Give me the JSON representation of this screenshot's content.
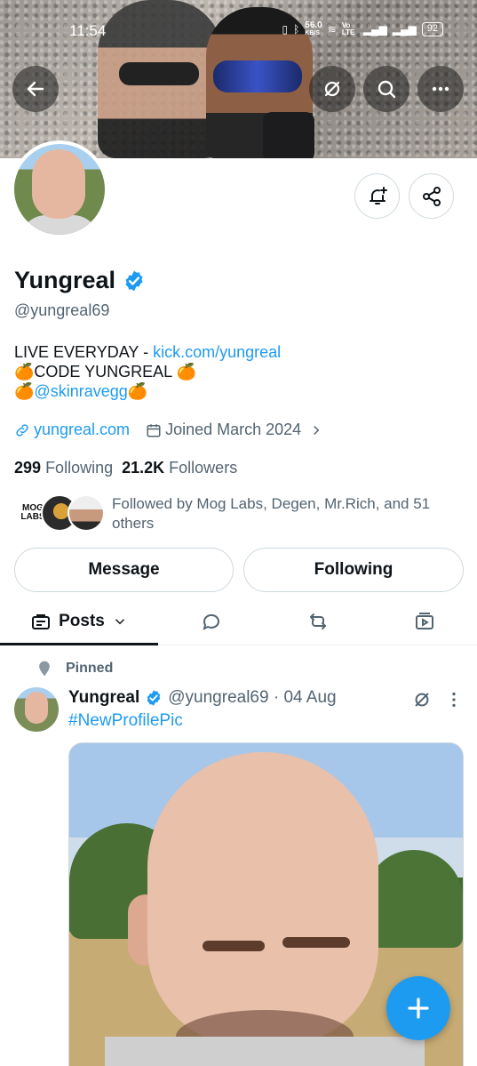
{
  "status_bar": {
    "time": "11:54",
    "network_speed": "56.0",
    "network_unit": "KB/S",
    "volte": "Vo LTE",
    "battery": "92"
  },
  "profile": {
    "name": "Yungreal",
    "handle": "@yungreal69",
    "bio_line1_prefix": "LIVE EVERYDAY - ",
    "bio_line1_link": "kick.com/yungreal",
    "bio_line2": "🍊CODE YUNGREAL 🍊",
    "bio_line3_pre": "🍊",
    "bio_line3_link": "@skinravegg",
    "bio_line3_post": "🍊",
    "website": "yungreal.com",
    "joined": "Joined March 2024",
    "following_count": "299",
    "following_label": "Following",
    "followers_count": "21.2K",
    "followers_label": "Followers",
    "followed_by": "Followed by Mog Labs, Degen, Mr.Rich, and 51 others",
    "mog_labs_logo_text": "MOG LABS"
  },
  "actions": {
    "message_label": "Message",
    "following_label": "Following"
  },
  "tabs": {
    "posts_label": "Posts"
  },
  "pinned_post": {
    "pinned_label": "Pinned",
    "author_name": "Yungreal",
    "meta": "@yungreal69 · 04 Aug",
    "hashtag": "#NewProfilePic"
  },
  "colors": {
    "accent": "#1d9bf0",
    "text_primary": "#0f1419",
    "text_secondary": "#536471",
    "border": "#cfd9de"
  }
}
